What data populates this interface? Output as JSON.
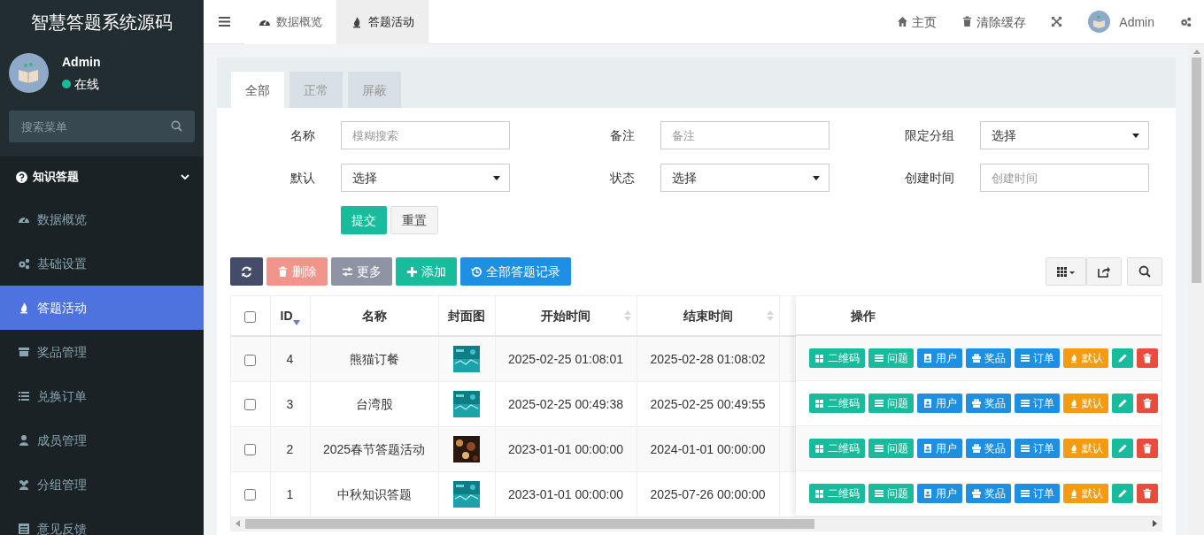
{
  "sidebar": {
    "logo": "智慧答题系统源码",
    "user": {
      "name": "Admin",
      "status": "在线",
      "online": true
    },
    "search": {
      "placeholder": "搜索菜单"
    },
    "menu": [
      {
        "label": "知识答题",
        "kind": "group",
        "expanded": true,
        "children": [
          {
            "label": "数据概览",
            "selected": false
          },
          {
            "label": "基础设置",
            "selected": false
          },
          {
            "label": "答题活动",
            "selected": true
          },
          {
            "label": "奖品管理",
            "selected": false
          },
          {
            "label": "兑换订单",
            "selected": false
          },
          {
            "label": "成员管理",
            "selected": false
          },
          {
            "label": "分组管理",
            "selected": false
          },
          {
            "label": "意见反馈",
            "selected": false
          }
        ]
      }
    ]
  },
  "header": {
    "nav_tabs": [
      {
        "label": "数据概览",
        "selected": false
      },
      {
        "label": "答题活动",
        "selected": true
      }
    ],
    "right_items": [
      {
        "kind": "home",
        "label": "主页"
      },
      {
        "kind": "trash",
        "label": "清除缓存"
      },
      {
        "kind": "fullscreen"
      },
      {
        "kind": "user",
        "label": "Admin"
      },
      {
        "kind": "settings"
      }
    ]
  },
  "panel": {
    "tabs": [
      {
        "label": "全部",
        "selected": true
      },
      {
        "label": "正常",
        "selected": false
      },
      {
        "label": "屏蔽",
        "selected": false
      }
    ],
    "filters": [
      {
        "label": "名称",
        "kind": "text",
        "placeholder": "模糊搜索"
      },
      {
        "label": "备注",
        "kind": "text",
        "placeholder": "备注"
      },
      {
        "label": "限定分组",
        "kind": "select",
        "value": "选择"
      },
      {
        "label": "默认",
        "kind": "select",
        "value": "选择"
      },
      {
        "label": "状态",
        "kind": "select",
        "value": "选择"
      },
      {
        "label": "创建时间",
        "kind": "text",
        "placeholder": "创建时间"
      }
    ],
    "form_buttons": [
      {
        "kind": "submit",
        "label": "提交"
      },
      {
        "kind": "reset",
        "label": "重置"
      }
    ],
    "toolbar": [
      {
        "kind": "refresh",
        "disabled": false
      },
      {
        "kind": "delete",
        "label": "删除",
        "disabled": true
      },
      {
        "kind": "more",
        "label": "更多",
        "disabled": true
      },
      {
        "kind": "add",
        "label": "添加",
        "disabled": false
      },
      {
        "kind": "history",
        "label": "全部答题记录",
        "disabled": false
      }
    ],
    "toolbar_right": [
      {
        "kind": "columns"
      },
      {
        "kind": "export"
      },
      {
        "kind": "search"
      }
    ],
    "table": {
      "select_all": {
        "checked": false
      },
      "columns": [
        {
          "label": "ID",
          "sortable": false,
          "sorted": true
        },
        {
          "label": "名称",
          "sortable": false,
          "sorted": false
        },
        {
          "label": "封面图",
          "sortable": false,
          "sorted": false
        },
        {
          "label": "开始时间",
          "sortable": true,
          "sorted": false
        },
        {
          "label": "结束时间",
          "sortable": true,
          "sorted": false
        }
      ],
      "action_column": "操作",
      "rows": [
        {
          "checked": false,
          "id": "4",
          "name": "熊猫订餐",
          "start": "2025-02-25 01:08:01",
          "end": "2025-02-28 01:08:02",
          "actions": [
            {
              "kind": "qrcode",
              "label": "二维码"
            },
            {
              "kind": "questions",
              "label": "问题"
            },
            {
              "kind": "users",
              "label": "用户"
            },
            {
              "kind": "prizes",
              "label": "奖品"
            },
            {
              "kind": "orders",
              "label": "订单"
            },
            {
              "kind": "default",
              "label": "默认"
            },
            {
              "kind": "edit"
            },
            {
              "kind": "delete"
            }
          ]
        },
        {
          "checked": false,
          "id": "3",
          "name": "台湾股",
          "start": "2025-02-25 00:49:38",
          "end": "2025-02-25 00:49:55",
          "actions": [
            {
              "kind": "qrcode",
              "label": "二维码"
            },
            {
              "kind": "questions",
              "label": "问题"
            },
            {
              "kind": "users",
              "label": "用户"
            },
            {
              "kind": "prizes",
              "label": "奖品"
            },
            {
              "kind": "orders",
              "label": "订单"
            },
            {
              "kind": "default",
              "label": "默认"
            },
            {
              "kind": "edit"
            },
            {
              "kind": "delete"
            }
          ]
        },
        {
          "checked": false,
          "id": "2",
          "name": "2025春节答题活动",
          "start": "2023-01-01 00:00:00",
          "end": "2024-01-01 00:00:00",
          "actions": [
            {
              "kind": "qrcode",
              "label": "二维码"
            },
            {
              "kind": "questions",
              "label": "问题"
            },
            {
              "kind": "users",
              "label": "用户"
            },
            {
              "kind": "prizes",
              "label": "奖品"
            },
            {
              "kind": "orders",
              "label": "订单"
            },
            {
              "kind": "default",
              "label": "默认"
            },
            {
              "kind": "edit"
            },
            {
              "kind": "delete"
            }
          ]
        },
        {
          "checked": false,
          "id": "1",
          "name": "中秋知识答题",
          "start": "2023-01-01 00:00:00",
          "end": "2025-07-26 00:00:00",
          "actions": [
            {
              "kind": "qrcode",
              "label": "二维码"
            },
            {
              "kind": "questions",
              "label": "问题"
            },
            {
              "kind": "users",
              "label": "用户"
            },
            {
              "kind": "prizes",
              "label": "奖品"
            },
            {
              "kind": "orders",
              "label": "订单"
            },
            {
              "kind": "default",
              "label": "默认"
            },
            {
              "kind": "edit"
            },
            {
              "kind": "delete"
            }
          ]
        }
      ]
    }
  }
}
